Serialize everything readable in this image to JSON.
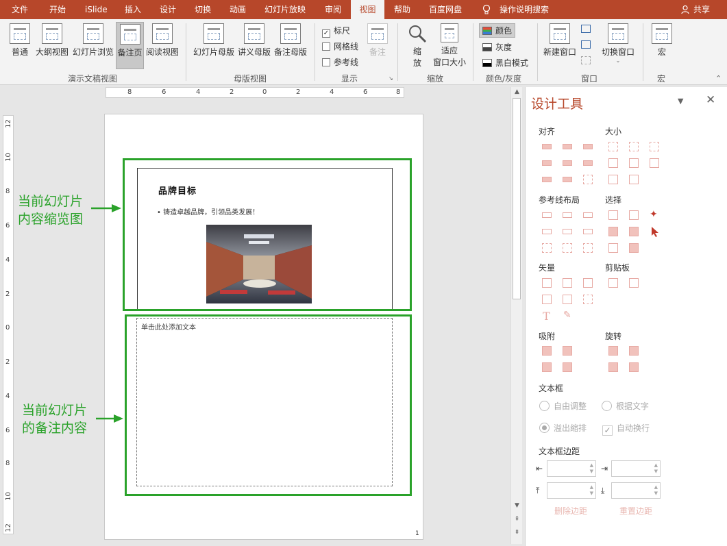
{
  "menu": {
    "tabs": [
      "文件",
      "开始",
      "iSlide",
      "插入",
      "设计",
      "切换",
      "动画",
      "幻灯片放映",
      "审阅",
      "视图",
      "帮助",
      "百度网盘"
    ],
    "active_tab": "视图",
    "tell_me": "操作说明搜索",
    "share": "共享"
  },
  "ribbon": {
    "presentation_views": {
      "label": "演示文稿视图",
      "buttons": [
        "普通",
        "大纲视图",
        "幻灯片浏览",
        "备注页",
        "阅读视图"
      ],
      "active": "备注页"
    },
    "master_views": {
      "label": "母版视图",
      "buttons": [
        "幻灯片母版",
        "讲义母版",
        "备注母版"
      ]
    },
    "show": {
      "label": "显示",
      "checkboxes": [
        {
          "label": "标尺",
          "checked": true
        },
        {
          "label": "网格线",
          "checked": false
        },
        {
          "label": "参考线",
          "checked": false
        }
      ],
      "notes_button": "备注"
    },
    "zoom": {
      "label": "缩放",
      "zoom_button_line1": "缩",
      "zoom_button_line2": "放",
      "fit_line1": "适应",
      "fit_line2": "窗口大小"
    },
    "color": {
      "label": "颜色/灰度",
      "options": [
        {
          "label": "颜色",
          "swatch": "#3a7bd5"
        },
        {
          "label": "灰度",
          "swatch": "#888888"
        },
        {
          "label": "黑白模式",
          "swatch": "#000000"
        }
      ]
    },
    "window": {
      "label": "窗口",
      "new_window": "新建窗口",
      "switch_window": "切换窗口"
    },
    "macro": {
      "label": "宏",
      "button": "宏"
    }
  },
  "ruler": {
    "horizontal": [
      "8",
      "6",
      "4",
      "2",
      "0",
      "2",
      "4",
      "6",
      "8"
    ],
    "vertical": [
      "12",
      "10",
      "8",
      "6",
      "4",
      "2",
      "0",
      "2",
      "4",
      "6",
      "8",
      "10",
      "12"
    ]
  },
  "slide": {
    "title": "品牌目标",
    "bullet": "• 铸造卓越品牌，引领品类发展！",
    "photo_icon": "showroom-photo"
  },
  "notes": {
    "placeholder": "单击此处添加文本"
  },
  "page_number": "1",
  "annotations": {
    "thumbnail_line1": "当前幻灯片",
    "thumbnail_line2": "内容缩览图",
    "notes_line1": "当前幻灯片",
    "notes_line2": "的备注内容",
    "color": "#2aa22a"
  },
  "panel": {
    "title": "设计工具",
    "sections": {
      "align": "对齐",
      "size": "大小",
      "guides": "参考线布局",
      "select": "选择",
      "vector": "矢量",
      "clipboard": "剪贴板",
      "snap": "吸附",
      "rotate": "旋转",
      "textbox": "文本框",
      "margins": "文本框边距"
    },
    "textbox_options": {
      "autofit": "自由调整",
      "by_text": "根据文字",
      "overflow": "溢出缩排",
      "wrap": "自动换行"
    },
    "margin_buttons": {
      "remove": "删除边距",
      "reset": "重置边距"
    },
    "accent": "#b7472a"
  },
  "colors": {
    "brand": "#b7472a",
    "callout": "#2aa22a"
  }
}
